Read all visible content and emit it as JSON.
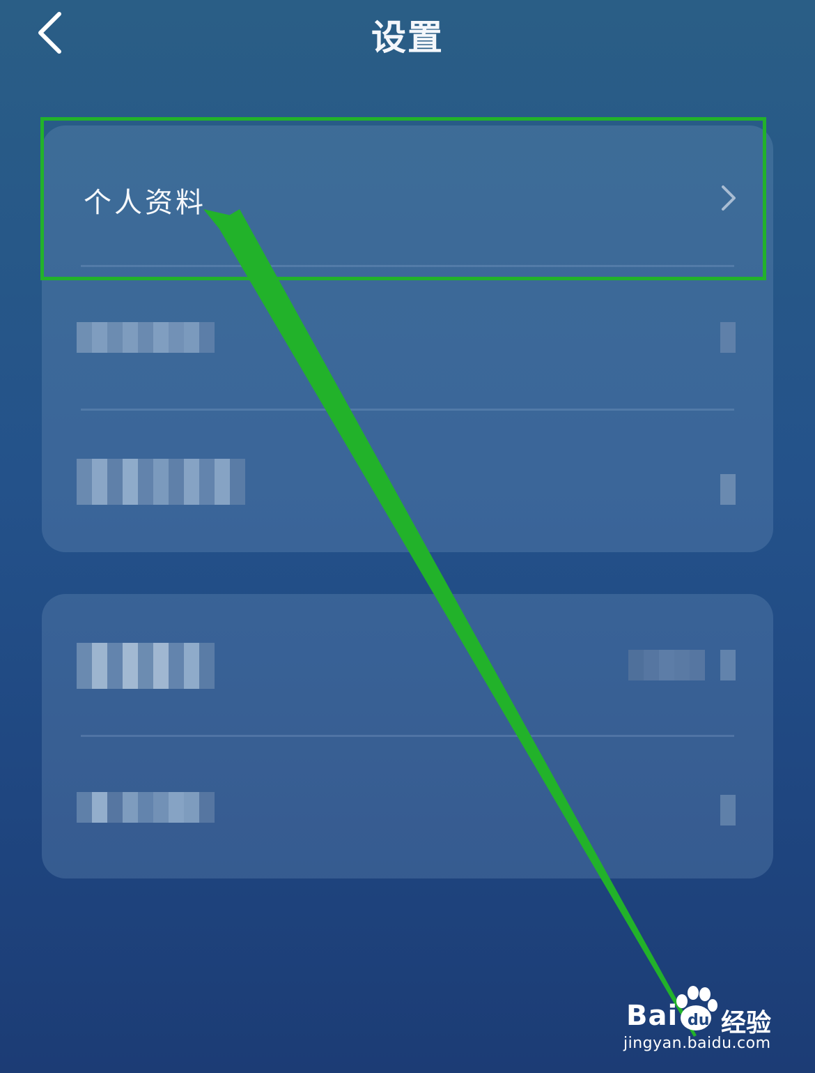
{
  "header": {
    "title": "设置",
    "back_icon": "chevron-left-icon"
  },
  "settings": {
    "group1": [
      {
        "label": "个人资料",
        "icon": "chevron-right-icon",
        "obscured": false
      },
      {
        "label": "",
        "icon": "chevron-right-icon",
        "obscured": true
      },
      {
        "label": "",
        "icon": "chevron-right-icon",
        "obscured": true
      }
    ],
    "group2": [
      {
        "label": "",
        "icon": "chevron-right-icon",
        "obscured": true
      },
      {
        "label": "",
        "icon": "chevron-right-icon",
        "obscured": true
      }
    ]
  },
  "annotation": {
    "highlight_color": "#22b22a",
    "arrow_color": "#22b22a"
  },
  "watermark": {
    "logo_text": "Bai",
    "logo_suffix": "du",
    "brand_text": "经验",
    "url": "jingyan.baidu.com"
  },
  "colors": {
    "background_top": "#2a5e86",
    "background_bottom": "#1c3c75",
    "text": "#f6f8fb"
  }
}
